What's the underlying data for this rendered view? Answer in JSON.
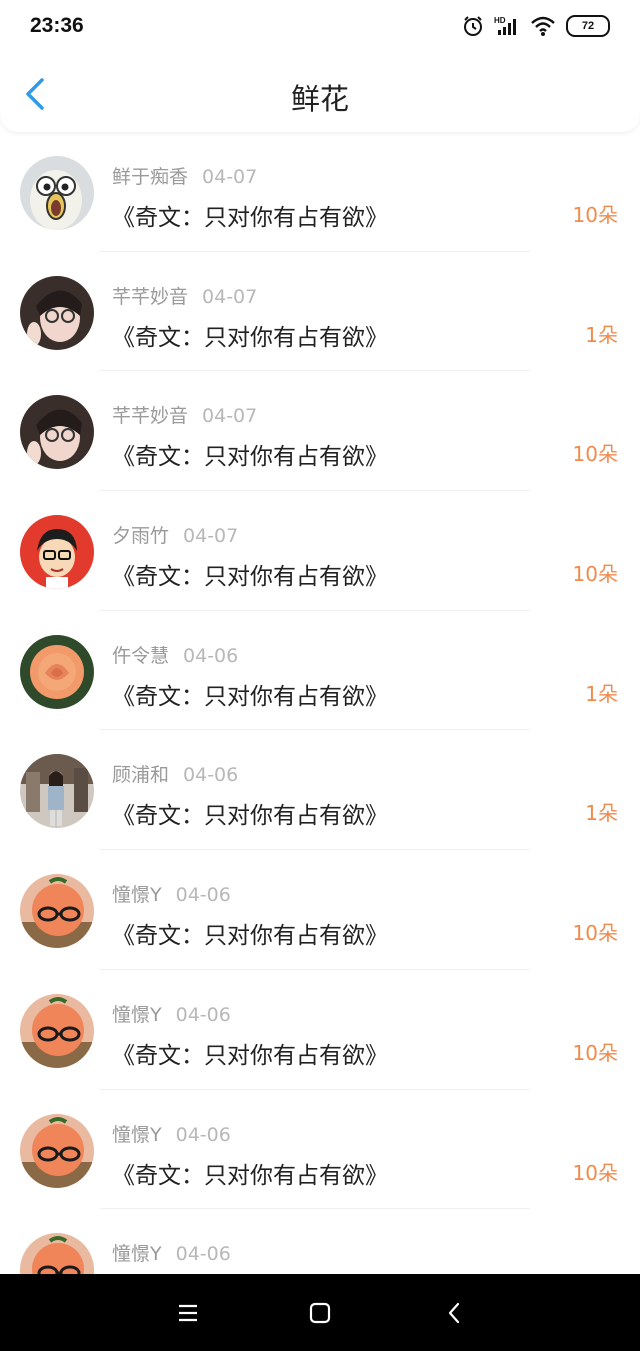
{
  "status_bar": {
    "time": "23:36",
    "battery": "72",
    "hd_label": "HD"
  },
  "header": {
    "title": "鲜花"
  },
  "list": [
    {
      "name": "鲜于痴香",
      "date": "04-07",
      "book": "《奇文：只对你有占有欲》",
      "count": "10朵",
      "avatar": "cartoon-bird"
    },
    {
      "name": "芊芊妙音",
      "date": "04-07",
      "book": "《奇文：只对你有占有欲》",
      "count": "1朵",
      "avatar": "girl-glasses"
    },
    {
      "name": "芊芊妙音",
      "date": "04-07",
      "book": "《奇文：只对你有占有欲》",
      "count": "10朵",
      "avatar": "girl-glasses"
    },
    {
      "name": "夕雨竹",
      "date": "04-07",
      "book": "《奇文：只对你有占有欲》",
      "count": "10朵",
      "avatar": "cartoon-boy"
    },
    {
      "name": "仵令慧",
      "date": "04-06",
      "book": "《奇文：只对你有占有欲》",
      "count": "1朵",
      "avatar": "rose"
    },
    {
      "name": "顾浦和",
      "date": "04-06",
      "book": "《奇文：只对你有占有欲》",
      "count": "1朵",
      "avatar": "street-photo"
    },
    {
      "name": "憧憬Y",
      "date": "04-06",
      "book": "《奇文：只对你有占有欲》",
      "count": "10朵",
      "avatar": "peach-glasses"
    },
    {
      "name": "憧憬Y",
      "date": "04-06",
      "book": "《奇文：只对你有占有欲》",
      "count": "10朵",
      "avatar": "peach-glasses"
    },
    {
      "name": "憧憬Y",
      "date": "04-06",
      "book": "《奇文：只对你有占有欲》",
      "count": "10朵",
      "avatar": "peach-glasses"
    },
    {
      "name": "憧憬Y",
      "date": "04-06",
      "book": "",
      "count": "",
      "avatar": "peach-glasses"
    }
  ],
  "colors": {
    "accent": "#2f9be8",
    "count": "#f28a4c",
    "meta": "#9a9a9a"
  },
  "navbar": {
    "icons": [
      "menu-icon",
      "home-icon",
      "back-icon"
    ]
  }
}
